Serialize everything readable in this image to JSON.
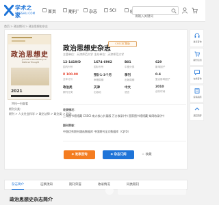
{
  "logo": {
    "name": "学术之家",
    "domain": "XUESHU.COM"
  },
  "nav": [
    {
      "label": "首页",
      "icon": "home-icon",
      "caret": ""
    },
    {
      "label": "期刊",
      "icon": "journal-icon",
      "caret": "▾"
    },
    {
      "label": "杂志",
      "icon": "magazine-icon",
      "caret": ""
    },
    {
      "label": "SCI",
      "icon": "sci-icon",
      "caret": ""
    },
    {
      "label": "经验",
      "icon": "experience-icon",
      "caret": "▾"
    }
  ],
  "search": {
    "placeholder": "请输入关键词"
  },
  "breadcrumb": "首页 > 政治期刊 > 政治思想史杂志",
  "journal": {
    "title": "政治思想史杂志",
    "badge": "CSSCI扩展版",
    "subtitle": "主管单位：天津师范大学   主办单位：天津师范大学",
    "cover_title": "政治思想史",
    "cover_en": "Journal of the History of Political Thought",
    "cover_year": "2021"
  },
  "info": [
    {
      "value": "12-1419/D",
      "key": "国内刊号"
    },
    {
      "value": "1674-6902",
      "key": "国际刊号"
    },
    {
      "value": "B01",
      "key": "中图分类"
    },
    {
      "value": "629",
      "key": "影响因子"
    },
    {
      "value": "¥ 100.00",
      "key": "全年订价",
      "price": true
    },
    {
      "value": "预计1-3个月",
      "key": "审稿周期"
    },
    {
      "value": "季刊",
      "key": "出版周期"
    },
    {
      "value": "0.4",
      "key": "复合影响因子"
    },
    {
      "value": "政治类",
      "key": "期刊分类"
    },
    {
      "value": "天津",
      "key": "出版地"
    },
    {
      "value": "中文",
      "key": "语言"
    },
    {
      "value": "2010",
      "key": "创刊时间"
    }
  ],
  "indexed": {
    "label": "收录情况：",
    "items": "上海图书馆馆藏   CSSCI 南大核心扩展版   万方收录(中)   国家图书馆馆藏   知网收录(中)"
  },
  "honors": {
    "label": "期刊荣誉：",
    "items": "中国优秀期刊遴选数据库   中国期刊全文数据库（CJFD）"
  },
  "buttons": {
    "submit": "⊕ 发表咨询",
    "subscribe": "⊕ 杂志订阅",
    "favorite": "☆ 收藏"
  },
  "left_meta": {
    "qr": "扫一扫查看",
    "row1": "期刊分类：",
    "row2": "期刊 > 人文社会科学 > 政治法律 > 政治类 > 政治"
  },
  "side": [
    {
      "label": "发表咨询",
      "icon": "headset-icon"
    },
    {
      "label": "期刊订阅",
      "icon": "cart-icon"
    },
    {
      "label": "在线咨询",
      "icon": "chat-icon"
    },
    {
      "label": "投稿指南",
      "icon": "book-icon"
    },
    {
      "label": "返回顶部",
      "icon": "arrow-up-icon"
    }
  ],
  "tabs": [
    "杂志简介",
    "征稿须知",
    "期刊荣誉",
    "收录情况",
    "同类期刊"
  ],
  "intro_title": "政治思想史杂志简介",
  "colors": {
    "brand": "#1e74d8",
    "accent": "#f47c20",
    "price": "#e5412d"
  }
}
